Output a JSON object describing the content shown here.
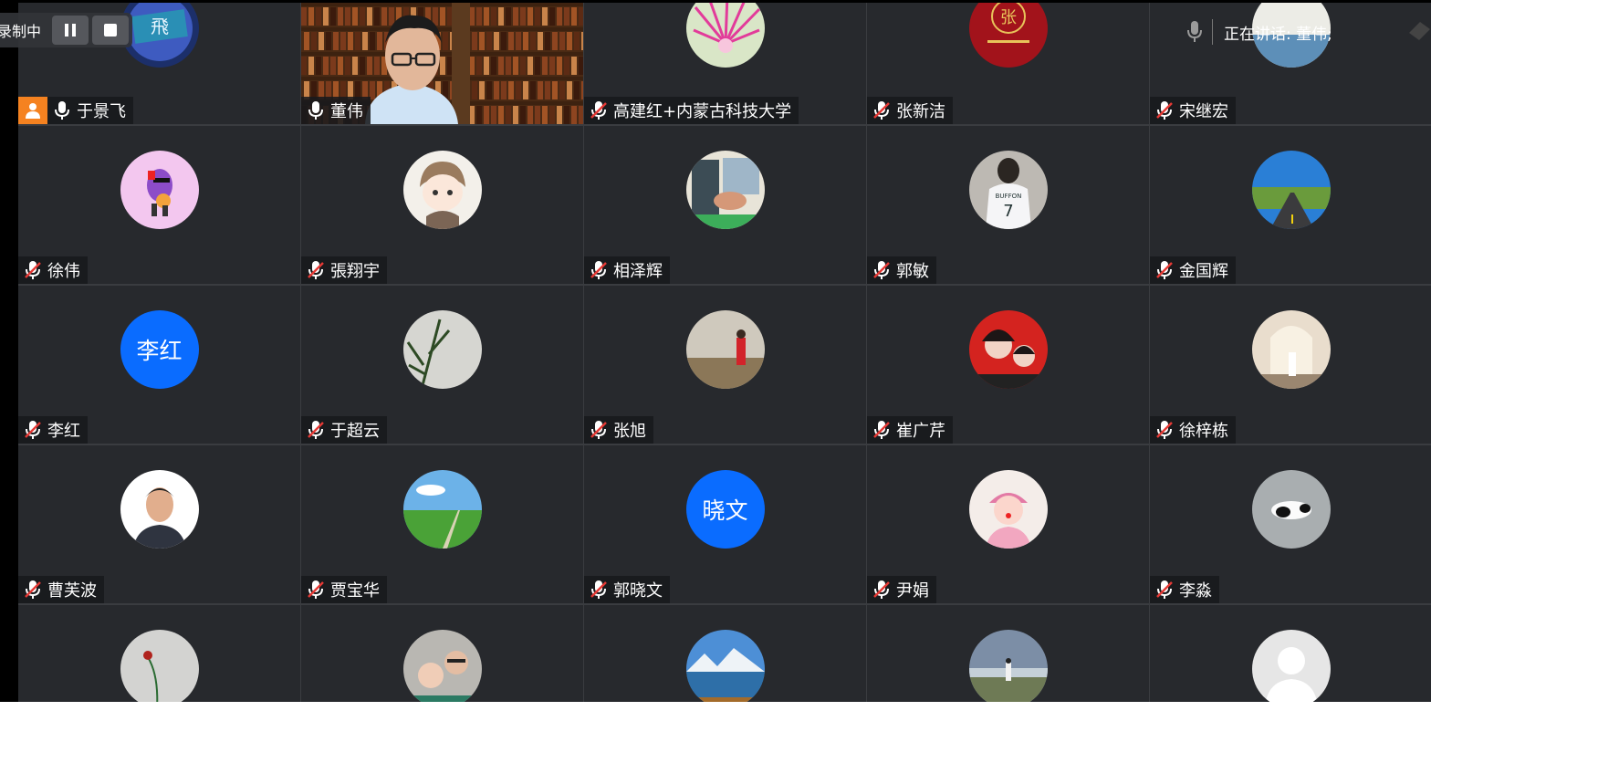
{
  "recording": {
    "label": "录制中",
    "pause_icon": "pause-icon",
    "stop_icon": "stop-icon"
  },
  "speaking": {
    "label": "正在讲话: 董伟;"
  },
  "colors": {
    "tile_bg": "#27292d",
    "active_speaker_border": "#2fcc53",
    "avatar_blue": "#0a6cff",
    "host_badge": "#f58220",
    "muted_red": "#e53935"
  },
  "participants": [
    {
      "name": "于景飞",
      "muted": false,
      "avatar": "fei-logo",
      "host": true
    },
    {
      "name": "董伟",
      "muted": false,
      "video": true,
      "speaking": true
    },
    {
      "name": "高建红+内蒙古科技大学",
      "muted": true,
      "avatar": "pink-flower"
    },
    {
      "name": "张新洁",
      "muted": true,
      "avatar": "red-zhang-logo"
    },
    {
      "name": "宋继宏",
      "muted": true,
      "avatar": "photo-top"
    },
    {
      "name": "徐伟",
      "muted": true,
      "avatar": "purple-cartoon"
    },
    {
      "name": "張翔宇",
      "muted": true,
      "avatar": "anime-boy"
    },
    {
      "name": "相泽辉",
      "muted": true,
      "avatar": "hand-photo"
    },
    {
      "name": "郭敏",
      "muted": true,
      "avatar": "jersey-back"
    },
    {
      "name": "金国辉",
      "muted": true,
      "avatar": "road-landscape"
    },
    {
      "name": "李红",
      "muted": true,
      "avatar_text": "李红"
    },
    {
      "name": "于超云",
      "muted": true,
      "avatar": "plant-leaves"
    },
    {
      "name": "张旭",
      "muted": true,
      "avatar": "field-person"
    },
    {
      "name": "崔广芹",
      "muted": true,
      "avatar": "mother-child"
    },
    {
      "name": "徐梓栋",
      "muted": true,
      "avatar": "church-wedding"
    },
    {
      "name": "曹芙波",
      "muted": true,
      "avatar": "man-portrait"
    },
    {
      "name": "贾宝华",
      "muted": true,
      "avatar": "green-meadow"
    },
    {
      "name": "郭晓文",
      "muted": true,
      "avatar_text": "晓文"
    },
    {
      "name": "尹娟",
      "muted": true,
      "avatar": "child-pink"
    },
    {
      "name": "李淼",
      "muted": true,
      "avatar": "sleeping-dog"
    },
    {
      "avatar": "red-flower"
    },
    {
      "avatar": "father-child"
    },
    {
      "avatar": "lake-mountains"
    },
    {
      "avatar": "beach-person"
    },
    {
      "avatar": "default-silhouette"
    }
  ]
}
